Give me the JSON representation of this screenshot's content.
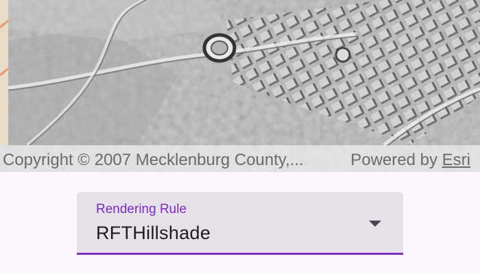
{
  "map": {
    "attribution_copyright": "Copyright © 2007 Mecklenburg County,...",
    "attribution_powered_by": "Powered by",
    "attribution_esri": "Esri"
  },
  "rendering_rule": {
    "label": "Rendering Rule",
    "selected_value": "RFTHillshade"
  },
  "colors": {
    "accent": "#7e2fc3",
    "label": "#7a2bbf",
    "field_background": "#e6e0e9",
    "page_background": "#fdf7fd"
  },
  "icons": {
    "dropdown_caret": "chevron-down-icon"
  }
}
